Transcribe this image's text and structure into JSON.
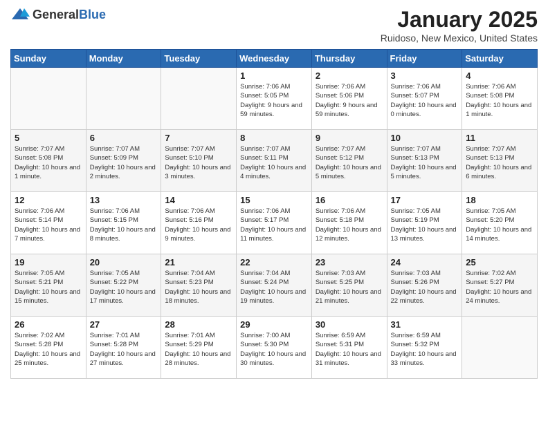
{
  "header": {
    "logo": {
      "general": "General",
      "blue": "Blue"
    },
    "title": "January 2025",
    "location": "Ruidoso, New Mexico, United States"
  },
  "weekdays": [
    "Sunday",
    "Monday",
    "Tuesday",
    "Wednesday",
    "Thursday",
    "Friday",
    "Saturday"
  ],
  "weeks": [
    [
      null,
      null,
      null,
      {
        "day": "1",
        "sunrise": "7:06 AM",
        "sunset": "5:05 PM",
        "daylight": "9 hours and 59 minutes."
      },
      {
        "day": "2",
        "sunrise": "7:06 AM",
        "sunset": "5:06 PM",
        "daylight": "9 hours and 59 minutes."
      },
      {
        "day": "3",
        "sunrise": "7:06 AM",
        "sunset": "5:07 PM",
        "daylight": "10 hours and 0 minutes."
      },
      {
        "day": "4",
        "sunrise": "7:06 AM",
        "sunset": "5:08 PM",
        "daylight": "10 hours and 1 minute."
      }
    ],
    [
      {
        "day": "5",
        "sunrise": "7:07 AM",
        "sunset": "5:08 PM",
        "daylight": "10 hours and 1 minute."
      },
      {
        "day": "6",
        "sunrise": "7:07 AM",
        "sunset": "5:09 PM",
        "daylight": "10 hours and 2 minutes."
      },
      {
        "day": "7",
        "sunrise": "7:07 AM",
        "sunset": "5:10 PM",
        "daylight": "10 hours and 3 minutes."
      },
      {
        "day": "8",
        "sunrise": "7:07 AM",
        "sunset": "5:11 PM",
        "daylight": "10 hours and 4 minutes."
      },
      {
        "day": "9",
        "sunrise": "7:07 AM",
        "sunset": "5:12 PM",
        "daylight": "10 hours and 5 minutes."
      },
      {
        "day": "10",
        "sunrise": "7:07 AM",
        "sunset": "5:13 PM",
        "daylight": "10 hours and 5 minutes."
      },
      {
        "day": "11",
        "sunrise": "7:07 AM",
        "sunset": "5:13 PM",
        "daylight": "10 hours and 6 minutes."
      }
    ],
    [
      {
        "day": "12",
        "sunrise": "7:06 AM",
        "sunset": "5:14 PM",
        "daylight": "10 hours and 7 minutes."
      },
      {
        "day": "13",
        "sunrise": "7:06 AM",
        "sunset": "5:15 PM",
        "daylight": "10 hours and 8 minutes."
      },
      {
        "day": "14",
        "sunrise": "7:06 AM",
        "sunset": "5:16 PM",
        "daylight": "10 hours and 9 minutes."
      },
      {
        "day": "15",
        "sunrise": "7:06 AM",
        "sunset": "5:17 PM",
        "daylight": "10 hours and 11 minutes."
      },
      {
        "day": "16",
        "sunrise": "7:06 AM",
        "sunset": "5:18 PM",
        "daylight": "10 hours and 12 minutes."
      },
      {
        "day": "17",
        "sunrise": "7:05 AM",
        "sunset": "5:19 PM",
        "daylight": "10 hours and 13 minutes."
      },
      {
        "day": "18",
        "sunrise": "7:05 AM",
        "sunset": "5:20 PM",
        "daylight": "10 hours and 14 minutes."
      }
    ],
    [
      {
        "day": "19",
        "sunrise": "7:05 AM",
        "sunset": "5:21 PM",
        "daylight": "10 hours and 15 minutes."
      },
      {
        "day": "20",
        "sunrise": "7:05 AM",
        "sunset": "5:22 PM",
        "daylight": "10 hours and 17 minutes."
      },
      {
        "day": "21",
        "sunrise": "7:04 AM",
        "sunset": "5:23 PM",
        "daylight": "10 hours and 18 minutes."
      },
      {
        "day": "22",
        "sunrise": "7:04 AM",
        "sunset": "5:24 PM",
        "daylight": "10 hours and 19 minutes."
      },
      {
        "day": "23",
        "sunrise": "7:03 AM",
        "sunset": "5:25 PM",
        "daylight": "10 hours and 21 minutes."
      },
      {
        "day": "24",
        "sunrise": "7:03 AM",
        "sunset": "5:26 PM",
        "daylight": "10 hours and 22 minutes."
      },
      {
        "day": "25",
        "sunrise": "7:02 AM",
        "sunset": "5:27 PM",
        "daylight": "10 hours and 24 minutes."
      }
    ],
    [
      {
        "day": "26",
        "sunrise": "7:02 AM",
        "sunset": "5:28 PM",
        "daylight": "10 hours and 25 minutes."
      },
      {
        "day": "27",
        "sunrise": "7:01 AM",
        "sunset": "5:28 PM",
        "daylight": "10 hours and 27 minutes."
      },
      {
        "day": "28",
        "sunrise": "7:01 AM",
        "sunset": "5:29 PM",
        "daylight": "10 hours and 28 minutes."
      },
      {
        "day": "29",
        "sunrise": "7:00 AM",
        "sunset": "5:30 PM",
        "daylight": "10 hours and 30 minutes."
      },
      {
        "day": "30",
        "sunrise": "6:59 AM",
        "sunset": "5:31 PM",
        "daylight": "10 hours and 31 minutes."
      },
      {
        "day": "31",
        "sunrise": "6:59 AM",
        "sunset": "5:32 PM",
        "daylight": "10 hours and 33 minutes."
      },
      null
    ]
  ]
}
